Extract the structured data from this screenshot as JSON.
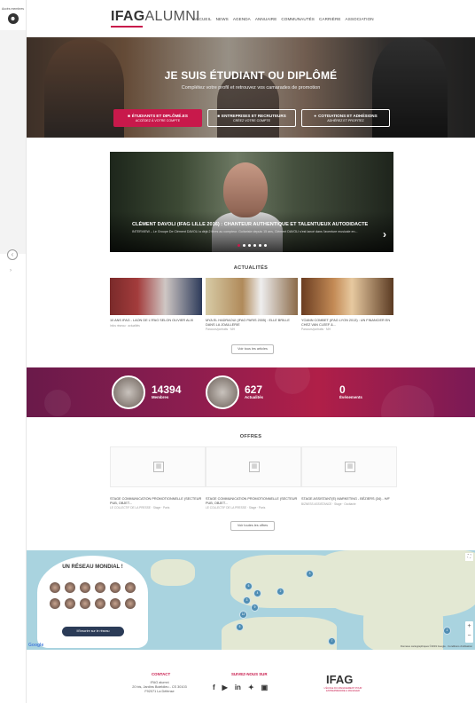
{
  "rail": {
    "account_label": "Accès membres"
  },
  "brand": {
    "logo_bold": "IFAG",
    "logo_light": "ALUMNI"
  },
  "nav": [
    "ACCUEIL",
    "NEWS",
    "AGENDA",
    "ANNUAIRE",
    "COMMUNAUTÉS",
    "CARRIÈRE",
    "ASSOCIATION"
  ],
  "hero": {
    "title": "JE SUIS ÉTUDIANT OU DIPLÔMÉ",
    "subtitle": "Complétez votre profil et retrouvez vos camarades de promotion",
    "buttons": [
      {
        "title": "ÉTUDIANTS ET DIPLÔMÉ.ES",
        "sub": "ACCÉDEZ À VOTRE COMPTE"
      },
      {
        "title": "ENTREPRISES ET RECRUTEURS",
        "sub": "CRÉEZ VOTRE COMPTE"
      },
      {
        "title": "COTISATIONS ET ADHÉSIONS",
        "sub": "ADHÉREZ ET PROFITEZ"
      }
    ]
  },
  "slider": {
    "title": "CLÉMENT DAVOLI (IFAG LILLE 2016) : CHANTEUR AUTHENTIQUE ET TALENTUEUX AUTODIDACTE",
    "text": "INTERVIEW – Le Groupe De Clément DAVOLI a déjà 2 titres au compteur. Guitariste depuis 15 ans, Clément DAVOLI s'est lancé dans l'aventure musicale en..."
  },
  "news": {
    "title": "ACTUALITÉS",
    "items": [
      {
        "title": "10 ANS IFAG - LAON DE L'IFAG SELON OLIVIER ALIX",
        "meta": "Infos réseau · actualités"
      },
      {
        "title": "MYA EL HADRAOUI (IFAG PARIS 2005) : ELLE BRILLE DANS LA JOAILLERIE",
        "meta": "Parcours/portraits · MH"
      },
      {
        "title": "YOANN COMBET (IFAG LYON 2013) : UN FINANCIER EN CHEZ VAN CLEEF &...",
        "meta": "Parcours/portraits · MH"
      }
    ],
    "more": "Voir tous les articles"
  },
  "stats": [
    {
      "number": "14394",
      "label": "Membres"
    },
    {
      "number": "627",
      "label": "Actualités"
    },
    {
      "number": "0",
      "label": "Événements"
    }
  ],
  "offers": {
    "title": "OFFRES",
    "items": [
      {
        "title": "STAGE COMMUNICATION PROMOTIONNELLE (SECTEUR PUB, OBJET...",
        "meta": "LE COLLECTIF DE LA PRESSE · Stage · Paris"
      },
      {
        "title": "STAGE COMMUNICATION PROMOTIONNELLE (SECTEUR PUB, OBJET...",
        "meta": "LE COLLECTIF DE LA PRESSE · Stage · Paris"
      },
      {
        "title": "STAGE ASSISTANT(E) MARKETING - BÉZIERS (34) - H/F",
        "meta": "BIZNESS ASSISTANCE · Stage · Occitanie"
      }
    ],
    "more": "Voir toutes les offres"
  },
  "map": {
    "title": "UN RÉSEAU MONDIAL !",
    "button": "M'inscrire sur le réseau",
    "clusters": [
      "6",
      "4",
      "3",
      "9",
      "12",
      "5",
      "2",
      "3",
      "7",
      "2",
      "4",
      "3"
    ],
    "google": "Google",
    "credit": "Données cartographiques ©2019 Google · Conditions d'utilisation"
  },
  "footer": {
    "contact_title": "CONTACT",
    "contact_lines": [
      "IFAG alumni",
      "20 bis, Jardins Boieldieu - CS 30103",
      "F92071 La Défense"
    ],
    "social_title": "SUIVEZ-NOUS SUR",
    "logo": "IFAG",
    "logo_sub": "L'ÉCOLE DU MANAGEMENT POUR ENTREPRENDRE & MANAGER"
  }
}
